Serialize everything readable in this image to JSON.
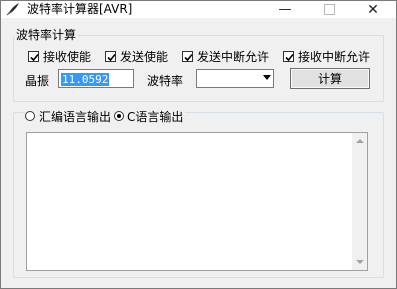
{
  "window": {
    "title": "波特率计算器[AVR]",
    "controls": {
      "minimize": "—",
      "close": "✕"
    }
  },
  "settings_group": {
    "legend": "波特率计算",
    "checkboxes": [
      {
        "label": "接收使能",
        "checked": true
      },
      {
        "label": "发送使能",
        "checked": true
      },
      {
        "label": "发送中断允许",
        "checked": true
      },
      {
        "label": "接收中断允许",
        "checked": true
      }
    ],
    "crystal_label": "晶振",
    "crystal_value": "11.0592",
    "baud_label": "波特率",
    "baud_value": "",
    "calc_button": "计算"
  },
  "output_group": {
    "radio_asm": {
      "label": "汇编语言输出",
      "selected": false
    },
    "radio_c": {
      "label": "C语言输出",
      "selected": true
    },
    "output_text": ""
  }
}
